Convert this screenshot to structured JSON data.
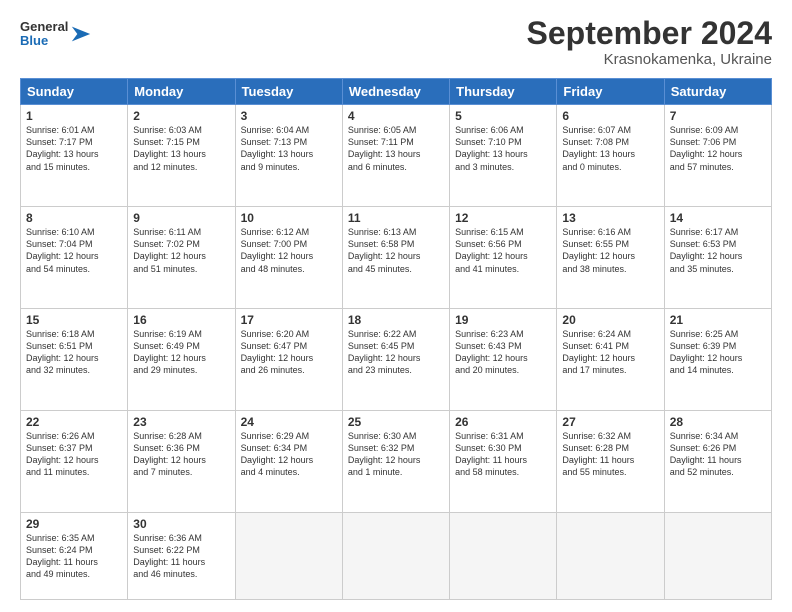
{
  "logo": {
    "line1": "General",
    "line2": "Blue"
  },
  "title": "September 2024",
  "subtitle": "Krasnokamenka, Ukraine",
  "days_of_week": [
    "Sunday",
    "Monday",
    "Tuesday",
    "Wednesday",
    "Thursday",
    "Friday",
    "Saturday"
  ],
  "weeks": [
    [
      {
        "day": "1",
        "info": "Sunrise: 6:01 AM\nSunset: 7:17 PM\nDaylight: 13 hours\nand 15 minutes."
      },
      {
        "day": "2",
        "info": "Sunrise: 6:03 AM\nSunset: 7:15 PM\nDaylight: 13 hours\nand 12 minutes."
      },
      {
        "day": "3",
        "info": "Sunrise: 6:04 AM\nSunset: 7:13 PM\nDaylight: 13 hours\nand 9 minutes."
      },
      {
        "day": "4",
        "info": "Sunrise: 6:05 AM\nSunset: 7:11 PM\nDaylight: 13 hours\nand 6 minutes."
      },
      {
        "day": "5",
        "info": "Sunrise: 6:06 AM\nSunset: 7:10 PM\nDaylight: 13 hours\nand 3 minutes."
      },
      {
        "day": "6",
        "info": "Sunrise: 6:07 AM\nSunset: 7:08 PM\nDaylight: 13 hours\nand 0 minutes."
      },
      {
        "day": "7",
        "info": "Sunrise: 6:09 AM\nSunset: 7:06 PM\nDaylight: 12 hours\nand 57 minutes."
      }
    ],
    [
      {
        "day": "8",
        "info": "Sunrise: 6:10 AM\nSunset: 7:04 PM\nDaylight: 12 hours\nand 54 minutes."
      },
      {
        "day": "9",
        "info": "Sunrise: 6:11 AM\nSunset: 7:02 PM\nDaylight: 12 hours\nand 51 minutes."
      },
      {
        "day": "10",
        "info": "Sunrise: 6:12 AM\nSunset: 7:00 PM\nDaylight: 12 hours\nand 48 minutes."
      },
      {
        "day": "11",
        "info": "Sunrise: 6:13 AM\nSunset: 6:58 PM\nDaylight: 12 hours\nand 45 minutes."
      },
      {
        "day": "12",
        "info": "Sunrise: 6:15 AM\nSunset: 6:56 PM\nDaylight: 12 hours\nand 41 minutes."
      },
      {
        "day": "13",
        "info": "Sunrise: 6:16 AM\nSunset: 6:55 PM\nDaylight: 12 hours\nand 38 minutes."
      },
      {
        "day": "14",
        "info": "Sunrise: 6:17 AM\nSunset: 6:53 PM\nDaylight: 12 hours\nand 35 minutes."
      }
    ],
    [
      {
        "day": "15",
        "info": "Sunrise: 6:18 AM\nSunset: 6:51 PM\nDaylight: 12 hours\nand 32 minutes."
      },
      {
        "day": "16",
        "info": "Sunrise: 6:19 AM\nSunset: 6:49 PM\nDaylight: 12 hours\nand 29 minutes."
      },
      {
        "day": "17",
        "info": "Sunrise: 6:20 AM\nSunset: 6:47 PM\nDaylight: 12 hours\nand 26 minutes."
      },
      {
        "day": "18",
        "info": "Sunrise: 6:22 AM\nSunset: 6:45 PM\nDaylight: 12 hours\nand 23 minutes."
      },
      {
        "day": "19",
        "info": "Sunrise: 6:23 AM\nSunset: 6:43 PM\nDaylight: 12 hours\nand 20 minutes."
      },
      {
        "day": "20",
        "info": "Sunrise: 6:24 AM\nSunset: 6:41 PM\nDaylight: 12 hours\nand 17 minutes."
      },
      {
        "day": "21",
        "info": "Sunrise: 6:25 AM\nSunset: 6:39 PM\nDaylight: 12 hours\nand 14 minutes."
      }
    ],
    [
      {
        "day": "22",
        "info": "Sunrise: 6:26 AM\nSunset: 6:37 PM\nDaylight: 12 hours\nand 11 minutes."
      },
      {
        "day": "23",
        "info": "Sunrise: 6:28 AM\nSunset: 6:36 PM\nDaylight: 12 hours\nand 7 minutes."
      },
      {
        "day": "24",
        "info": "Sunrise: 6:29 AM\nSunset: 6:34 PM\nDaylight: 12 hours\nand 4 minutes."
      },
      {
        "day": "25",
        "info": "Sunrise: 6:30 AM\nSunset: 6:32 PM\nDaylight: 12 hours\nand 1 minute."
      },
      {
        "day": "26",
        "info": "Sunrise: 6:31 AM\nSunset: 6:30 PM\nDaylight: 11 hours\nand 58 minutes."
      },
      {
        "day": "27",
        "info": "Sunrise: 6:32 AM\nSunset: 6:28 PM\nDaylight: 11 hours\nand 55 minutes."
      },
      {
        "day": "28",
        "info": "Sunrise: 6:34 AM\nSunset: 6:26 PM\nDaylight: 11 hours\nand 52 minutes."
      }
    ],
    [
      {
        "day": "29",
        "info": "Sunrise: 6:35 AM\nSunset: 6:24 PM\nDaylight: 11 hours\nand 49 minutes."
      },
      {
        "day": "30",
        "info": "Sunrise: 6:36 AM\nSunset: 6:22 PM\nDaylight: 11 hours\nand 46 minutes."
      },
      null,
      null,
      null,
      null,
      null
    ]
  ]
}
